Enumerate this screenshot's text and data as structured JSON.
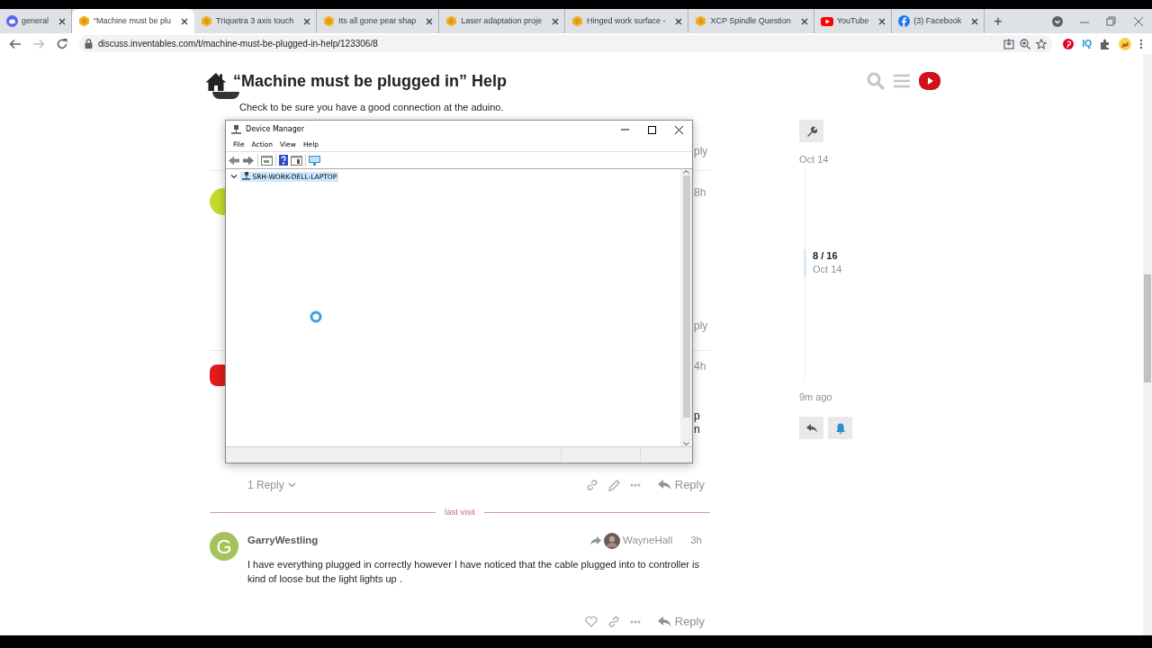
{
  "browser": {
    "tabs": [
      {
        "title": "general",
        "kind": "chat",
        "selected": false
      },
      {
        "title": "“Machine must be plu",
        "kind": "forum",
        "selected": true
      },
      {
        "title": "Triquetra 3 axis touch",
        "kind": "forum",
        "selected": false
      },
      {
        "title": "Its all gone pear shap",
        "kind": "forum",
        "selected": false
      },
      {
        "title": "Laser adaptation proje",
        "kind": "forum",
        "selected": false
      },
      {
        "title": "Hinged work surface -",
        "kind": "forum",
        "selected": false
      },
      {
        "title": "XCP Spindle Question",
        "kind": "forum",
        "selected": false
      },
      {
        "title": "YouTube",
        "kind": "video",
        "selected": false
      },
      {
        "title": "(3) Facebook",
        "kind": "social",
        "selected": false
      }
    ],
    "new_tab": "+",
    "url": "discuss.inventables.com/t/machine-must-be-plugged-in-help/123306/8",
    "extension_label": "IQ"
  },
  "page": {
    "title": "“Machine must be plugged in” Help",
    "first_post_text": "Check to be sure you have a good connection at the aduino.",
    "covered_fragments": [
      {
        "kind": "reply",
        "text": "ply"
      },
      {
        "kind": "time",
        "text": "8h"
      },
      {
        "kind": "reply",
        "text": "ply"
      },
      {
        "kind": "time",
        "text": "4h"
      },
      {
        "kind": "body",
        "text": "p"
      },
      {
        "kind": "body",
        "text": "n"
      }
    ],
    "post_actions": {
      "replies": "1 Reply",
      "reply": "Reply"
    },
    "divider_label": "last visit",
    "post": {
      "avatar_letter": "G",
      "author": "GarryWestling",
      "reply_to": "WayneHall",
      "time": "3h",
      "body": "I have everything plugged in correctly however I have noticed that the cable plugged into to controller is kind of loose but the light lights up ."
    },
    "bottom_actions": {
      "reply": "Reply"
    },
    "timeline": {
      "start": "Oct 14",
      "position": "8 / 16",
      "position_date": "Oct 14",
      "end": "9m ago"
    }
  },
  "device_manager": {
    "title": "Device Manager",
    "menus": [
      "File",
      "Action",
      "View",
      "Help"
    ],
    "tree": [
      {
        "label": "SRH-WORK-DELL-LAPTOP",
        "expanded": true,
        "selected": true
      }
    ],
    "loading": true
  }
}
